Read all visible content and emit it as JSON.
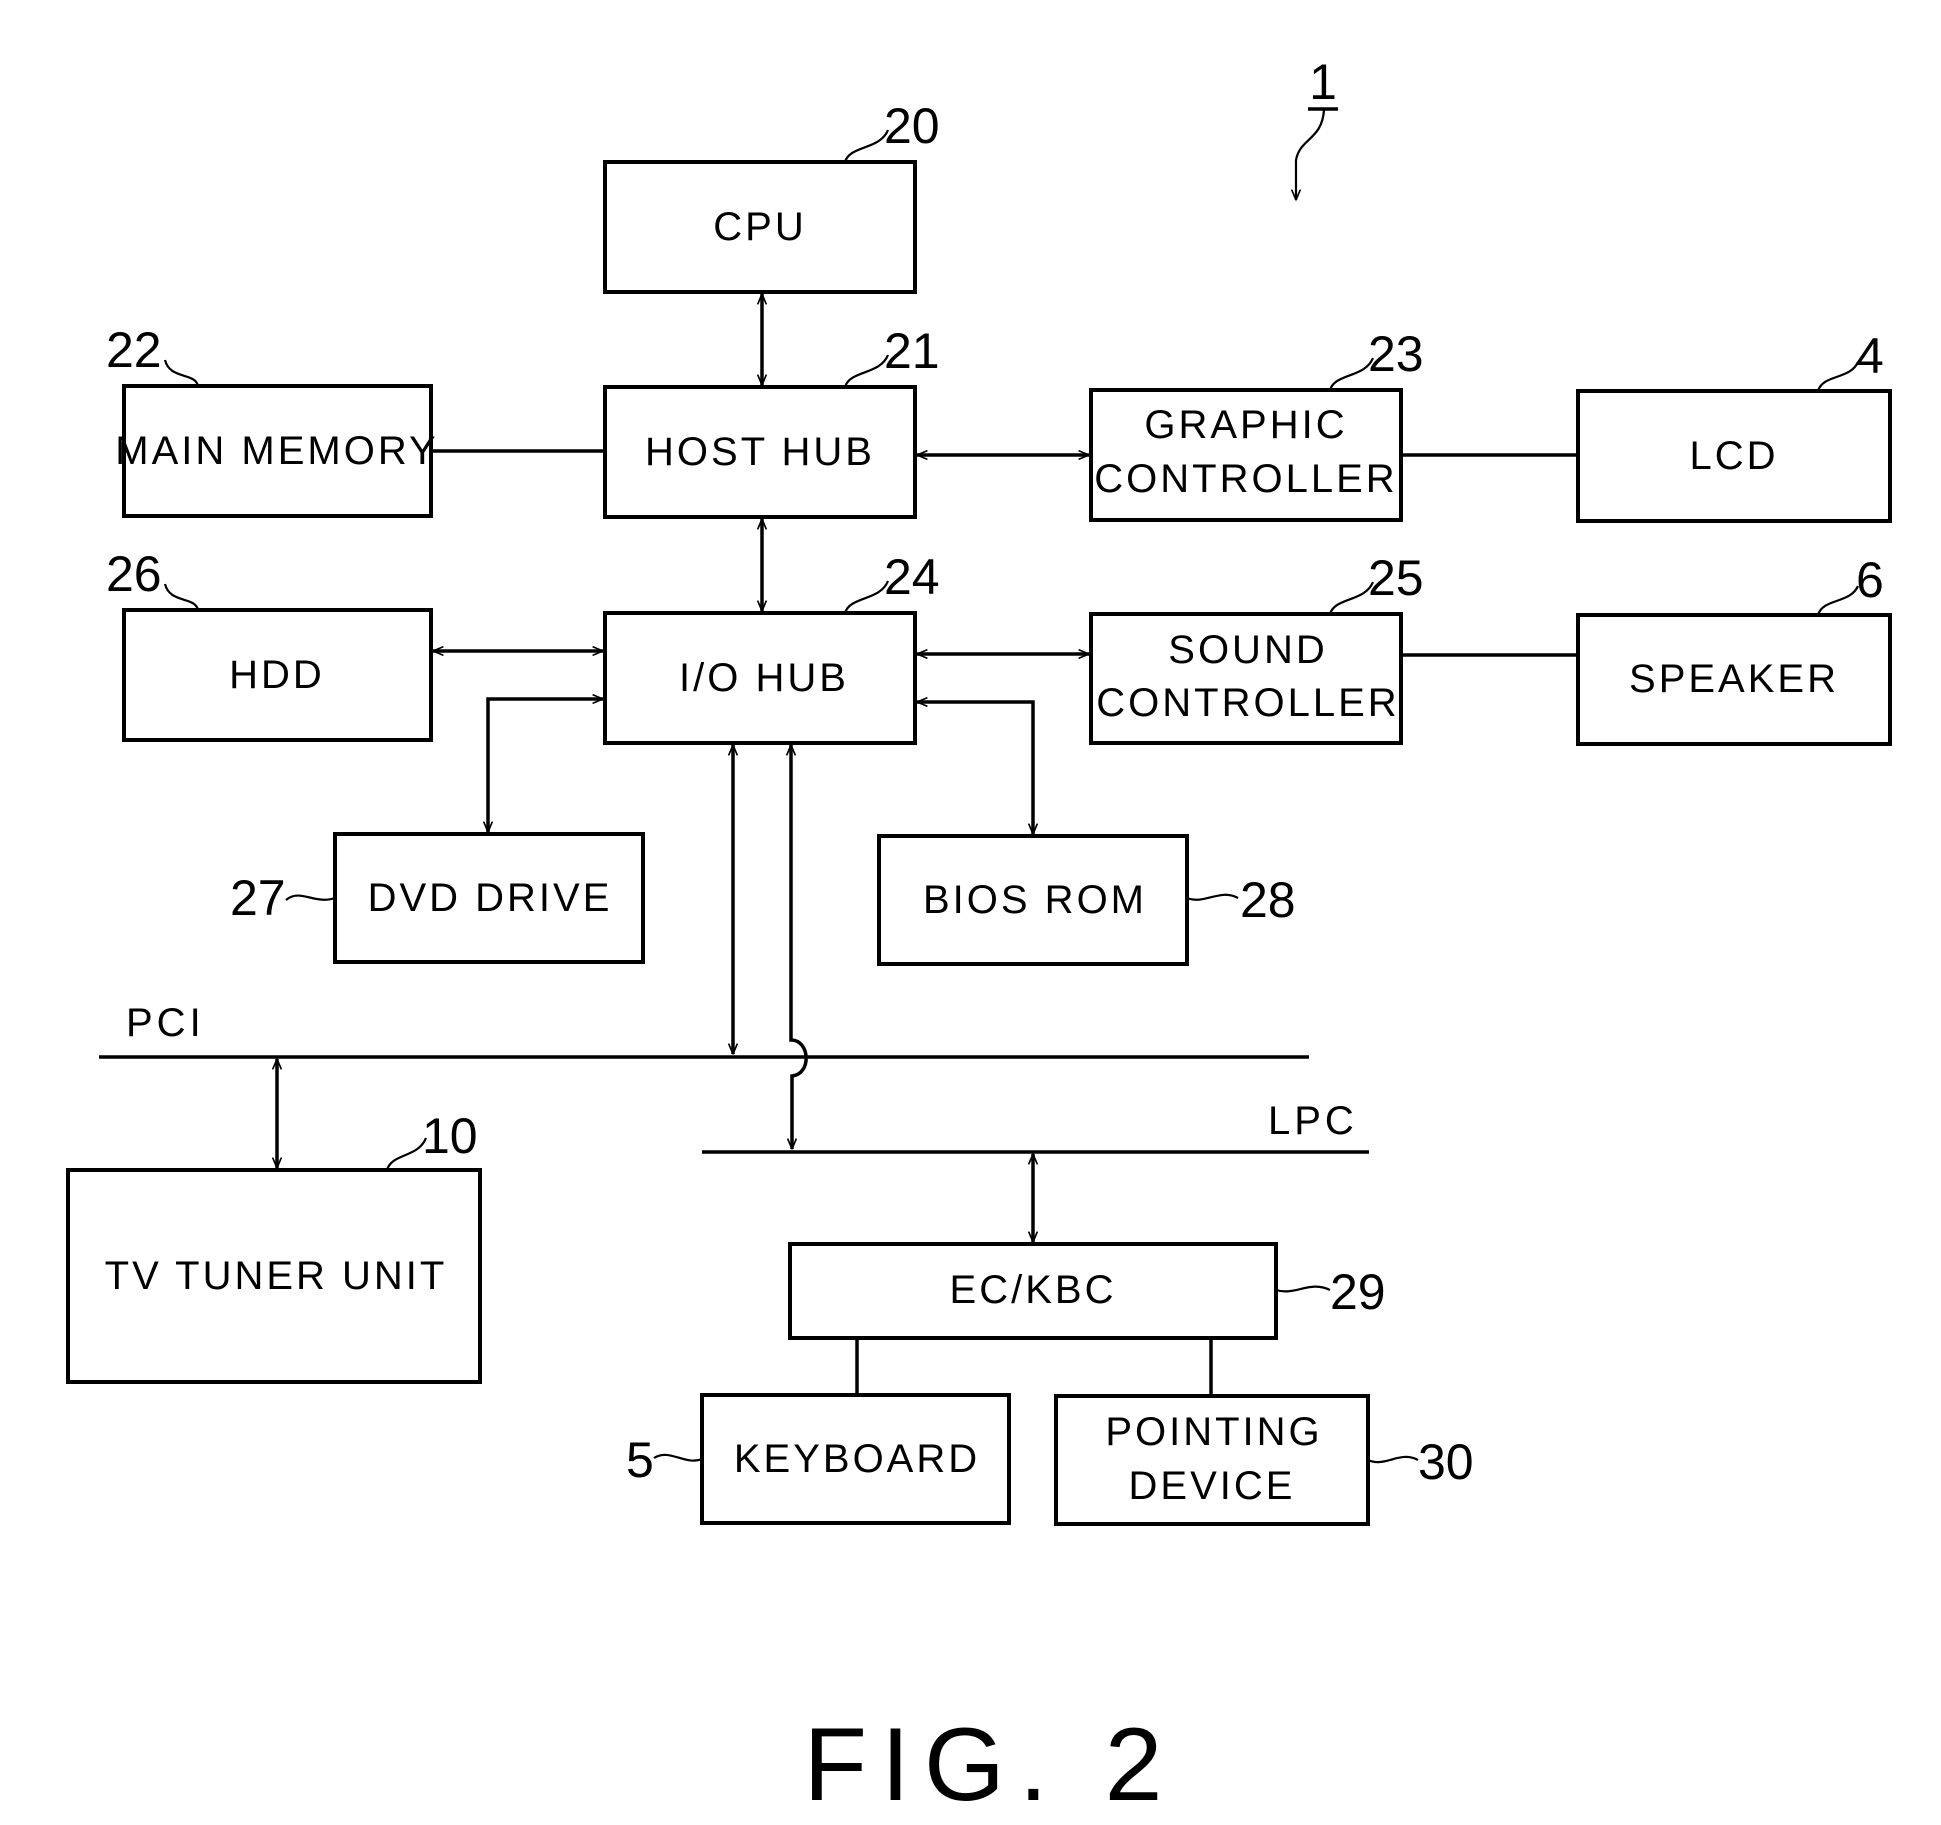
{
  "figure": {
    "caption": "FIG. 2",
    "system_ref": "1"
  },
  "blocks": {
    "cpu": {
      "label": "CPU",
      "ref": "20"
    },
    "host_hub": {
      "label": "HOST HUB",
      "ref": "21"
    },
    "main_memory": {
      "label": "MAIN MEMORY",
      "ref": "22"
    },
    "graphic_controller": {
      "label_lines": [
        "GRAPHIC",
        "CONTROLLER"
      ],
      "ref": "23"
    },
    "lcd": {
      "label": "LCD",
      "ref": "4"
    },
    "hdd": {
      "label": "HDD",
      "ref": "26"
    },
    "io_hub": {
      "label": "I/O HUB",
      "ref": "24"
    },
    "sound_controller": {
      "label_lines": [
        "SOUND",
        "CONTROLLER"
      ],
      "ref": "25"
    },
    "speaker": {
      "label": "SPEAKER",
      "ref": "6"
    },
    "dvd_drive": {
      "label": "DVD DRIVE",
      "ref": "27"
    },
    "bios_rom": {
      "label": "BIOS ROM",
      "ref": "28"
    },
    "tv_tuner": {
      "label": "TV TUNER UNIT",
      "ref": "10"
    },
    "ec_kbc": {
      "label": "EC/KBC",
      "ref": "29"
    },
    "keyboard": {
      "label": "KEYBOARD",
      "ref": "5"
    },
    "pointing_device": {
      "label_lines": [
        "POINTING",
        "DEVICE"
      ],
      "ref": "30"
    }
  },
  "buses": {
    "pci": "PCI",
    "lpc": "LPC"
  }
}
